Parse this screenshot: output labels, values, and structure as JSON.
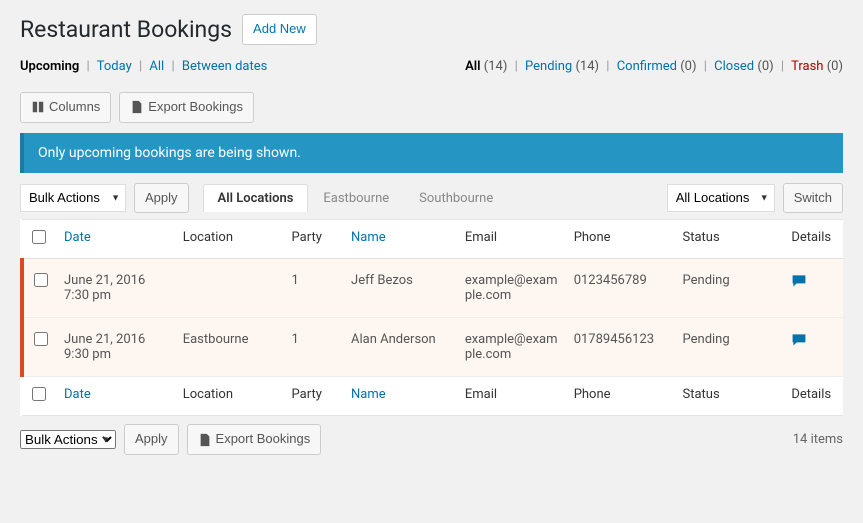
{
  "header": {
    "title": "Restaurant Bookings",
    "add_new": "Add New"
  },
  "date_filters": {
    "upcoming": "Upcoming",
    "today": "Today",
    "all": "All",
    "between": "Between dates"
  },
  "status_filters": {
    "all": {
      "label": "All",
      "count": "(14)"
    },
    "pending": {
      "label": "Pending",
      "count": "(14)"
    },
    "confirmed": {
      "label": "Confirmed",
      "count": "(0)"
    },
    "closed": {
      "label": "Closed",
      "count": "(0)"
    },
    "trash": {
      "label": "Trash",
      "count": "(0)"
    }
  },
  "toolbar": {
    "columns": "Columns",
    "export": "Export Bookings"
  },
  "notice": "Only upcoming bookings are being shown.",
  "bulk": {
    "label": "Bulk Actions",
    "apply": "Apply"
  },
  "loc_tabs": {
    "all": "All Locations",
    "east": "Eastbourne",
    "south": "Southbourne"
  },
  "loc_filter": {
    "select": "All Locations",
    "switch": "Switch"
  },
  "columns": {
    "date": "Date",
    "location": "Location",
    "party": "Party",
    "name": "Name",
    "email": "Email",
    "phone": "Phone",
    "status": "Status",
    "details": "Details"
  },
  "rows": [
    {
      "date_d": "June 21, 2016",
      "date_t": "7:30 pm",
      "location": "",
      "party": "1",
      "name": "Jeff Bezos",
      "email": "example@example.com",
      "phone": "0123456789",
      "status": "Pending"
    },
    {
      "date_d": "June 21, 2016",
      "date_t": "9:30 pm",
      "location": "Eastbourne",
      "party": "1",
      "name": "Alan Anderson",
      "email": "example@example.com",
      "phone": "01789456123",
      "status": "Pending"
    }
  ],
  "footer": {
    "items": "14 items"
  }
}
